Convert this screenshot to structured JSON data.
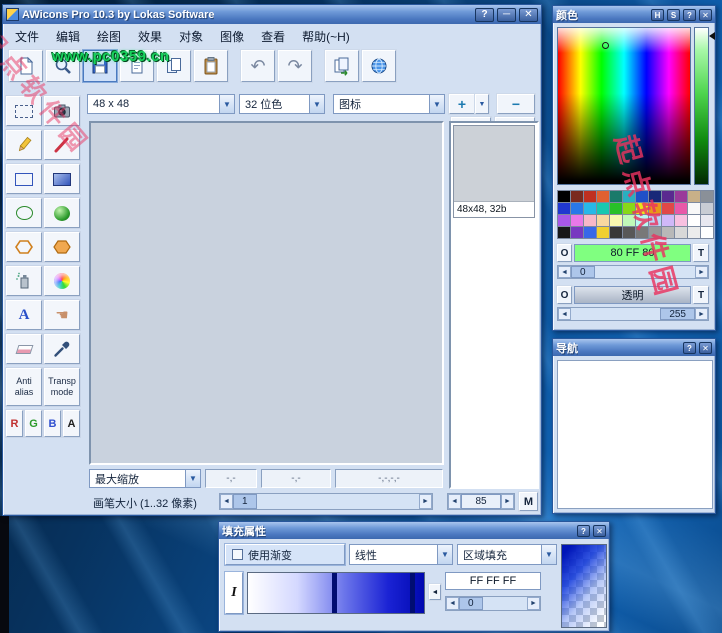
{
  "window": {
    "title": "AWicons Pro 10.3 by Lokas Software"
  },
  "icons": {
    "help": "?",
    "minimize": "─",
    "close": "✕",
    "dropdown": "▼",
    "up": "▲",
    "down": "▼",
    "left": "◄",
    "right": "►",
    "plus": "+",
    "minus": "−",
    "undo": "↶",
    "redo": "↷"
  },
  "menu": {
    "items": [
      "文件",
      "编辑",
      "绘图",
      "效果",
      "对象",
      "图像",
      "查看",
      "帮助(~H)"
    ]
  },
  "toolbar": {
    "buttons": [
      "new-icon",
      "zoom-icon",
      "save-icon",
      "copy-icon",
      "duplicate-icon",
      "paste-icon",
      "undo-icon",
      "redo-icon",
      "export-icon",
      "globe-icon"
    ]
  },
  "format": {
    "size": "48 x 48",
    "depth": "32 位色",
    "type": "图标"
  },
  "tools": {
    "antialias": [
      "Anti",
      "alias"
    ],
    "transp": [
      "Transp",
      "mode"
    ],
    "channels": [
      "R",
      "G",
      "B",
      "A"
    ],
    "text_label": "A"
  },
  "icon_list": {
    "selected_label": "48x48, 32b"
  },
  "statusbar": {
    "zoom": "最大缩放",
    "fields": [
      "-,-",
      "-,-",
      "-,-,-,-"
    ]
  },
  "brush": {
    "label": "画笔大小 (1..32 像素)",
    "size": "1",
    "right_value": "85",
    "m": "M"
  },
  "color_panel": {
    "title": "颜色",
    "buttons": [
      "H",
      "S",
      "?",
      "✕"
    ],
    "o_label": "O",
    "t_label": "T",
    "fg_value": "80 FF 80",
    "fg_color": "#80ff80",
    "alpha_value": "0",
    "bg_value": "透明",
    "bg_alpha": "255",
    "palette": [
      [
        "#000000",
        "#7a2a1e",
        "#c03020",
        "#e06030",
        "#1a7a6a",
        "#2ab0c0",
        "#2050c8",
        "#182878",
        "#5a2a90",
        "#9a3a9a",
        "#c8b088",
        "#8a9098"
      ],
      [
        "#2038d0",
        "#2878e8",
        "#28b8e8",
        "#18c8b0",
        "#28c028",
        "#88d818",
        "#e8e818",
        "#e89818",
        "#e04848",
        "#e858a8",
        "#f8f8f8",
        "#c8ccd4"
      ],
      [
        "#a858e8",
        "#e878e8",
        "#f8b8c8",
        "#f8d8a0",
        "#f8f8b0",
        "#c0f8b8",
        "#b8f8f0",
        "#b8d8f8",
        "#d0b8f8",
        "#f8c0e0",
        "#ffffff",
        "#e8e8f0"
      ],
      [
        "#181818",
        "#7838c0",
        "#3868e8",
        "#f0d030",
        "#383838",
        "#585858",
        "#787878",
        "#989898",
        "#b8b8b8",
        "#d8d8d8",
        "#ececec",
        "#ffffff"
      ]
    ]
  },
  "nav_panel": {
    "title": "导航",
    "buttons": [
      "?",
      "✕"
    ]
  },
  "fill_dialog": {
    "title": "填充属性",
    "buttons": [
      "?",
      "✕"
    ],
    "use_gradient": "使用渐变",
    "gradient_type": "线性",
    "fill_mode": "区域填充",
    "invert": "I",
    "color_value": "FF FF FF",
    "slider_value": "0"
  },
  "watermarks": {
    "green": "www.pc0359.cn",
    "red": "起点软件园",
    "green_color": "#17d35c",
    "red_color": "rgba(233,50,95,0.82)"
  }
}
